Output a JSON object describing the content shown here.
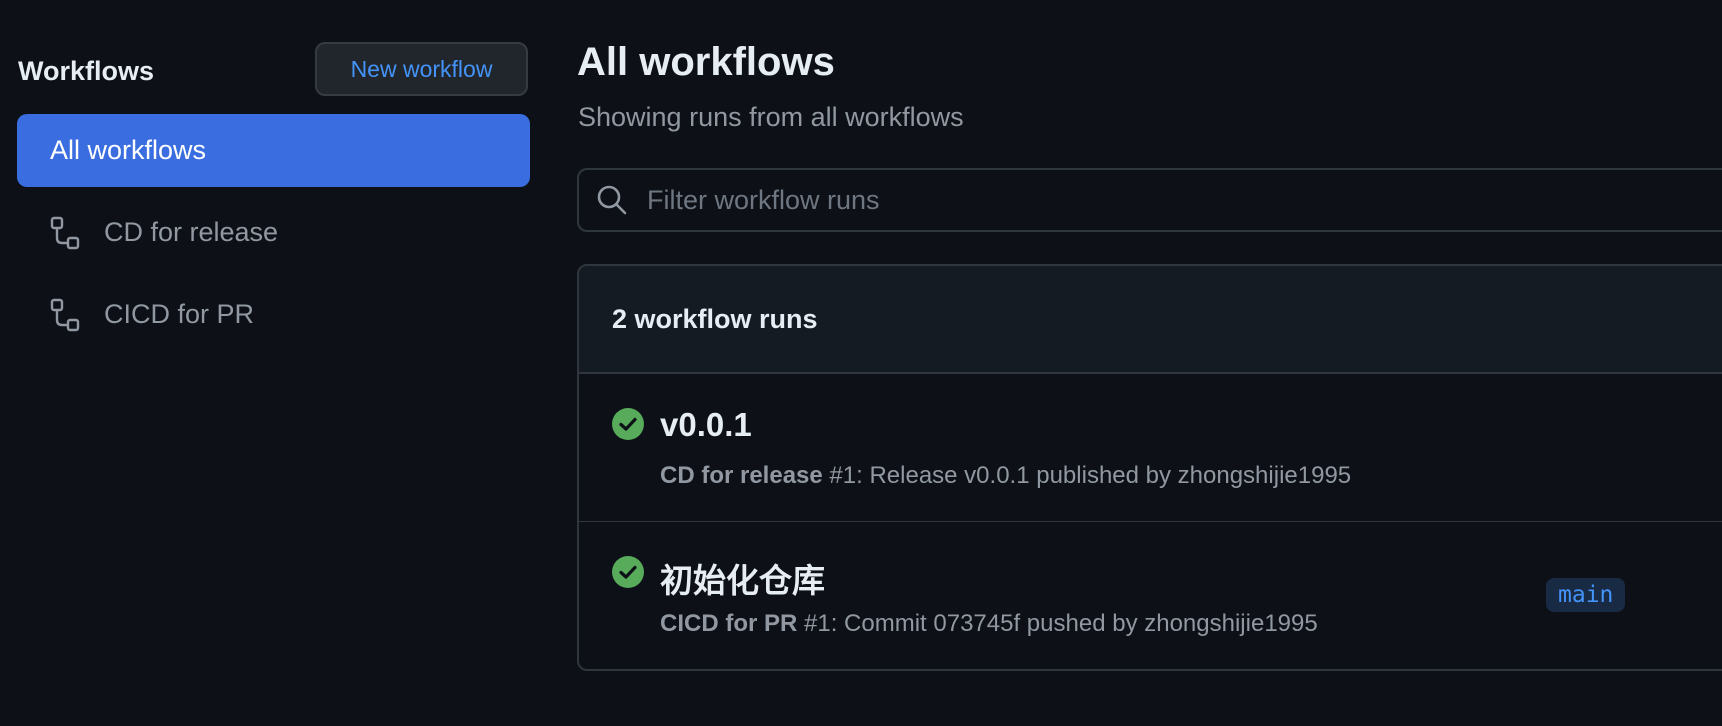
{
  "sidebar": {
    "title": "Workflows",
    "new_workflow_label": "New workflow",
    "items": [
      {
        "label": "All workflows",
        "active": true
      },
      {
        "label": "CD for release",
        "icon": "workflow-icon"
      },
      {
        "label": "CICD for PR",
        "icon": "workflow-icon"
      }
    ]
  },
  "main": {
    "title": "All workflows",
    "subtitle": "Showing runs from all workflows",
    "filter": {
      "placeholder": "Filter workflow runs",
      "value": ""
    },
    "runs_count_label": "2 workflow runs",
    "runs": [
      {
        "title": "v0.0.1",
        "workflow": "CD for release",
        "run_number": "#1",
        "description": ": Release v0.0.1 published by zhongshijie1995",
        "status": "success",
        "branch": ""
      },
      {
        "title": "初始化仓库",
        "workflow": "CICD for PR",
        "run_number": "#1",
        "description": ": Commit 073745f pushed by zhongshijie1995",
        "status": "success",
        "branch": "main"
      }
    ]
  },
  "colors": {
    "background": "#0d1117",
    "accent": "#3a6ee0",
    "link": "#4493f8",
    "success": "#57ab5a"
  }
}
